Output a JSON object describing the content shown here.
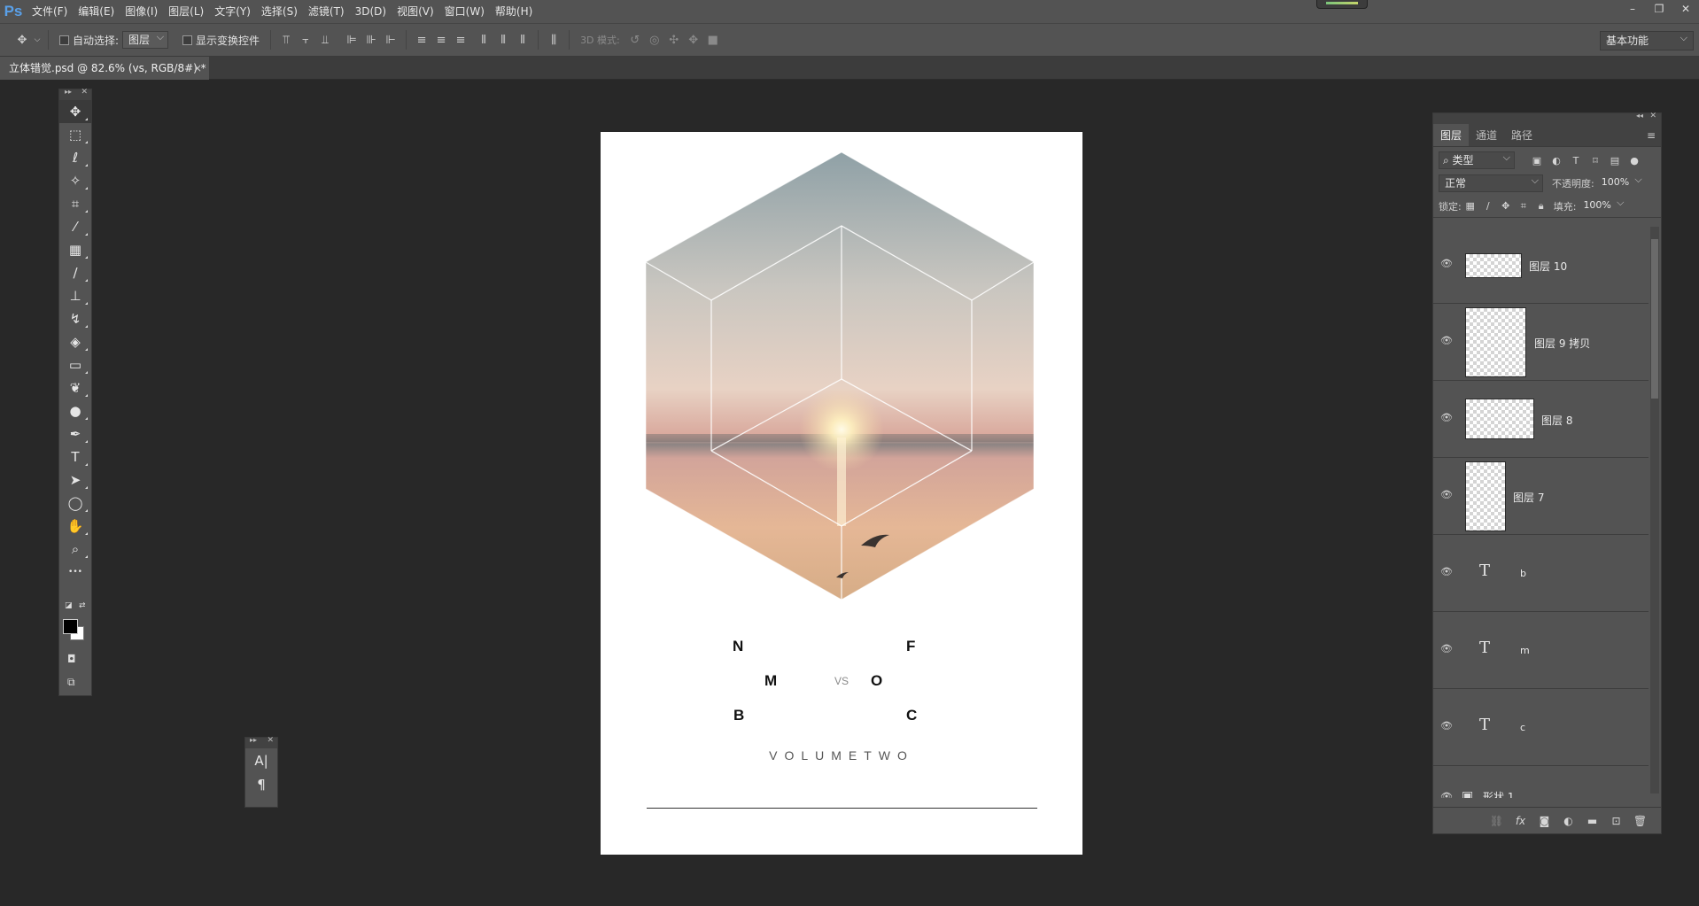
{
  "app": {
    "logo": "Ps",
    "menus": [
      "文件(F)",
      "编辑(E)",
      "图像(I)",
      "图层(L)",
      "文字(Y)",
      "选择(S)",
      "滤镜(T)",
      "3D(D)",
      "视图(V)",
      "窗口(W)",
      "帮助(H)"
    ],
    "window_controls": [
      "–",
      "❐",
      "✕"
    ]
  },
  "options": {
    "auto_select_label": "自动选择:",
    "auto_select_value": "图层",
    "show_transform_label": "显示变换控件",
    "mode_3d_label": "3D 模式:",
    "workspace": "基本功能"
  },
  "document": {
    "tab_title": "立体错觉.psd @ 82.6% (vs, RGB/8#) *",
    "tab_close": "×"
  },
  "poster": {
    "letters": {
      "n": "N",
      "f": "F",
      "m": "M",
      "o": "O",
      "b": "B",
      "c": "C"
    },
    "vs": "VS",
    "volume": "VOLUMETWO"
  },
  "tools": [
    {
      "name": "move-tool",
      "glyph": "✥"
    },
    {
      "name": "marquee-tool",
      "glyph": "⬚"
    },
    {
      "name": "lasso-tool",
      "glyph": "ℓ"
    },
    {
      "name": "magic-wand-tool",
      "glyph": "✧"
    },
    {
      "name": "crop-tool",
      "glyph": "⌗"
    },
    {
      "name": "eyedropper-tool",
      "glyph": "⁄"
    },
    {
      "name": "healing-brush-tool",
      "glyph": "▦"
    },
    {
      "name": "brush-tool",
      "glyph": "∕"
    },
    {
      "name": "stamp-tool",
      "glyph": "⊥"
    },
    {
      "name": "history-brush-tool",
      "glyph": "↯"
    },
    {
      "name": "eraser-tool",
      "glyph": "◈"
    },
    {
      "name": "gradient-tool",
      "glyph": "▭"
    },
    {
      "name": "blur-tool",
      "glyph": "❦"
    },
    {
      "name": "dodge-tool",
      "glyph": "●"
    },
    {
      "name": "pen-tool",
      "glyph": "✒"
    },
    {
      "name": "type-tool",
      "glyph": "T"
    },
    {
      "name": "path-selection-tool",
      "glyph": "➤"
    },
    {
      "name": "ellipse-tool",
      "glyph": "◯"
    },
    {
      "name": "hand-tool",
      "glyph": "✋"
    },
    {
      "name": "zoom-tool",
      "glyph": "⌕"
    },
    {
      "name": "more-tools",
      "glyph": "•••"
    }
  ],
  "char_panel": {
    "char_icon": "A|",
    "para_icon": "¶"
  },
  "layers_panel": {
    "tabs": [
      "图层",
      "通道",
      "路径"
    ],
    "filter_kind": "类型",
    "blend_mode": "正常",
    "opacity_label": "不透明度:",
    "opacity_value": "100%",
    "lock_label": "锁定:",
    "fill_label": "填充:",
    "fill_value": "100%",
    "layers": [
      {
        "name": "图层 10",
        "kind": "pixel"
      },
      {
        "name": "图层 9 拷贝",
        "kind": "pixel"
      },
      {
        "name": "图层 8",
        "kind": "pixel"
      },
      {
        "name": "图层 7",
        "kind": "pixel"
      },
      {
        "name": "b",
        "kind": "text"
      },
      {
        "name": "m",
        "kind": "text"
      },
      {
        "name": "c",
        "kind": "text"
      },
      {
        "name": "形状 1",
        "kind": "shape"
      }
    ]
  }
}
